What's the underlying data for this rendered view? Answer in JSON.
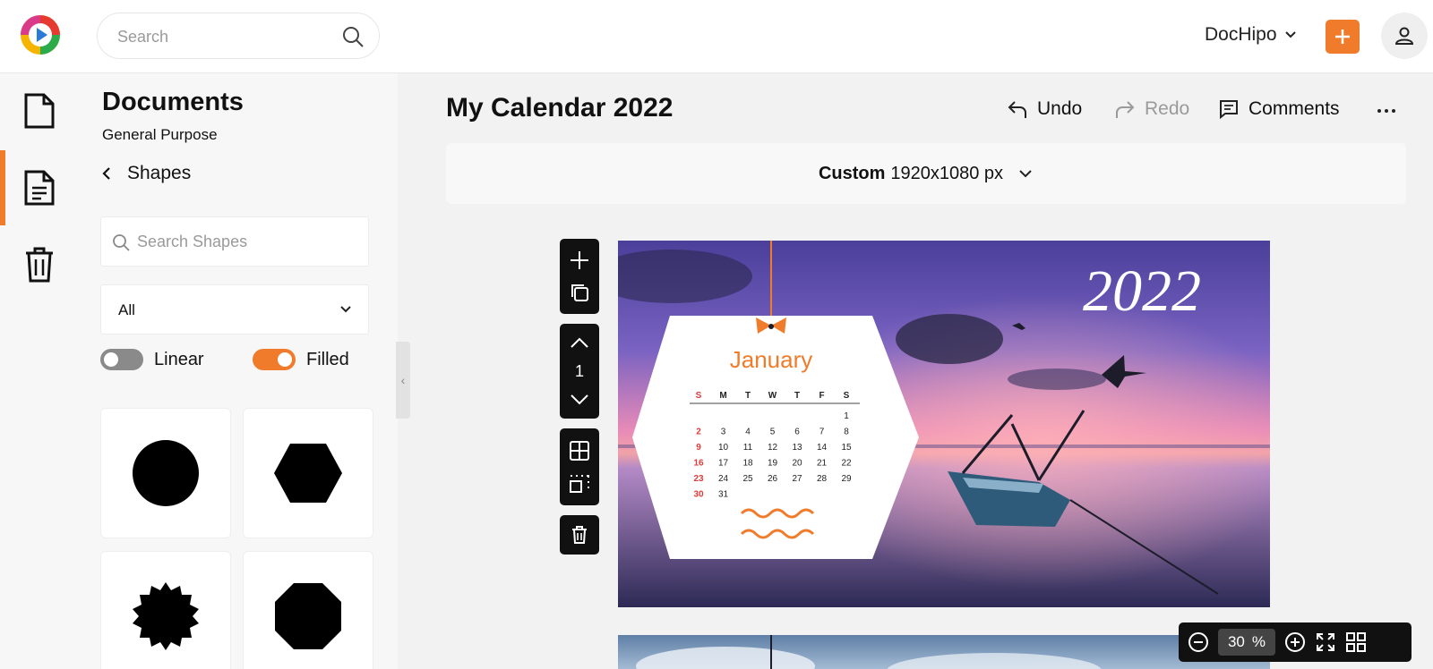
{
  "header": {
    "search_placeholder": "Search",
    "workspace": "DocHipo"
  },
  "panel": {
    "title": "Documents",
    "subtitle": "General Purpose",
    "back_label": "Shapes",
    "search_placeholder": "Search Shapes",
    "filter_value": "All",
    "toggle_linear_label": "Linear",
    "toggle_linear_on": false,
    "toggle_filled_label": "Filled",
    "toggle_filled_on": true,
    "shapes": [
      "circle-shape",
      "hexagon-shape",
      "starburst-shape",
      "octagon-shape"
    ]
  },
  "editor": {
    "doc_title": "My Calendar 2022",
    "undo": "Undo",
    "redo": "Redo",
    "comments": "Comments",
    "size_preset": "Custom",
    "size_value": "1920x1080 px",
    "page_number": "1",
    "zoom_value": "30",
    "zoom_unit": "%"
  },
  "calendar": {
    "year": "2022",
    "month": "January",
    "weekdays": [
      "S",
      "M",
      "T",
      "W",
      "T",
      "F",
      "S"
    ],
    "weeks": [
      [
        "",
        "",
        "",
        "",
        "",
        "",
        "1"
      ],
      [
        "2",
        "3",
        "4",
        "5",
        "6",
        "7",
        "8"
      ],
      [
        "9",
        "10",
        "11",
        "12",
        "13",
        "14",
        "15"
      ],
      [
        "16",
        "17",
        "18",
        "19",
        "20",
        "21",
        "22"
      ],
      [
        "23",
        "24",
        "25",
        "26",
        "27",
        "28",
        "29"
      ],
      [
        "30",
        "31",
        "",
        "",
        "",
        "",
        ""
      ]
    ]
  },
  "colors": {
    "accent": "#f07c2b",
    "sunday": "#e03a3a",
    "toolbar": "#111111"
  }
}
